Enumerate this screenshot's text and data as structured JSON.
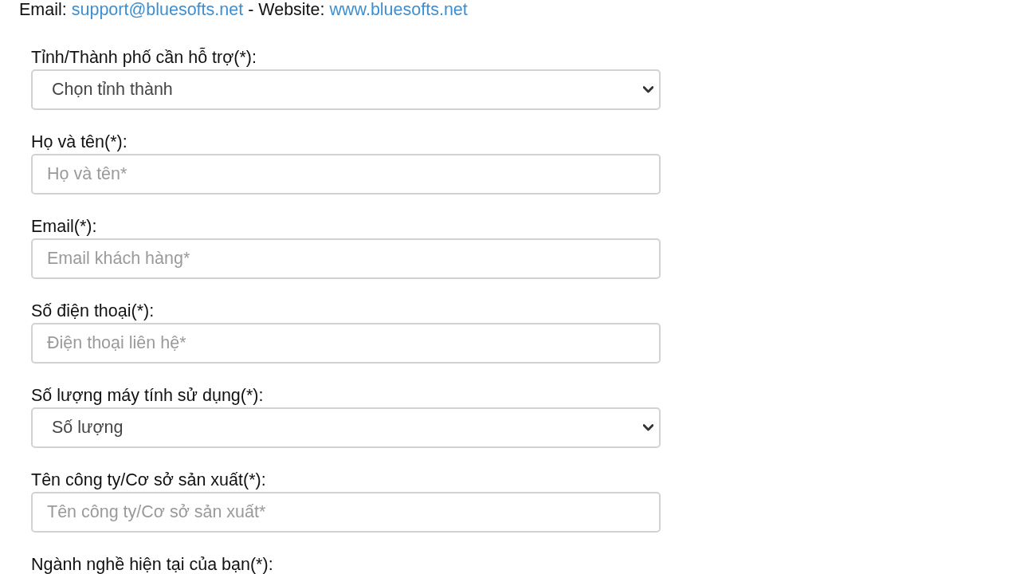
{
  "contact": {
    "parts": [
      {
        "kind": "text",
        "text": "Email: "
      },
      {
        "kind": "link",
        "text": "support@bluesofts.net"
      },
      {
        "kind": "text",
        "text": " - Website: "
      },
      {
        "kind": "link",
        "text": "www.bluesofts.net"
      }
    ]
  },
  "form": {
    "fields": [
      {
        "label": "Tỉnh/Thành phố cần hỗ trợ(*):",
        "kind": "select",
        "value": "Chọn tỉnh thành"
      },
      {
        "label": "Họ và tên(*):",
        "kind": "text",
        "placeholder": "Họ và tên*"
      },
      {
        "label": "Email(*):",
        "kind": "text",
        "placeholder": "Email khách hàng*"
      },
      {
        "label": "Số điện thoại(*):",
        "kind": "text",
        "placeholder": "Điện thoại liên hệ*"
      },
      {
        "label": "Số lượng máy tính sử dụng(*):",
        "kind": "select",
        "value": "Số lượng"
      },
      {
        "label": "Tên công ty/Cơ sở sản xuất(*):",
        "kind": "text",
        "placeholder": "Tên công ty/Cơ sở sản xuất*"
      },
      {
        "label": "Ngành nghề hiện tại của bạn(*):"
      }
    ]
  }
}
